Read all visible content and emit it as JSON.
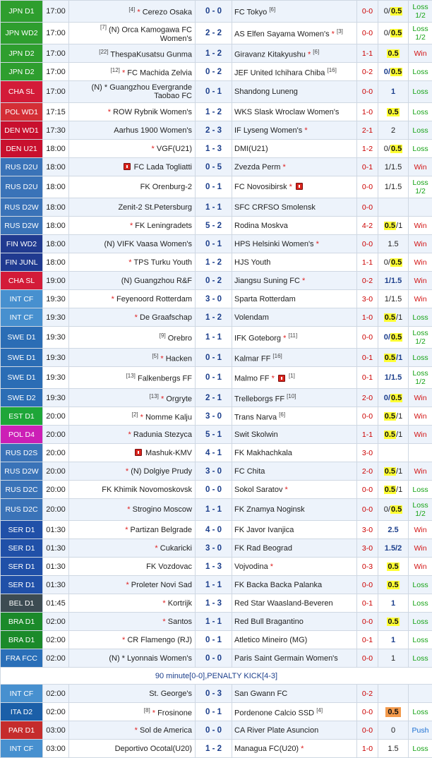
{
  "colors": {
    "jpn": "#2e9e2e",
    "cha": "#d31b38",
    "pol": "#d42e36",
    "den": "#c8102e",
    "rus": "#3a73b8",
    "fin": "#203a90",
    "intcf": "#4790cf",
    "swe": "#2b6db5",
    "est": "#1ea638",
    "pol4": "#cc1fb6",
    "ser": "#2050a8",
    "bel": "#3c4b52",
    "bra": "#1b8a2a",
    "fra": "#2a6fb8",
    "ita": "#1b5fa8",
    "par": "#c52c2c",
    "win": "#d21414",
    "loss": "#17a317",
    "push": "#1b6fd3"
  },
  "matches": [
    {
      "league": "JPN D1",
      "color": "jpn",
      "time": "17:00",
      "home_rank": "[4]",
      "home_star": true,
      "home": "Cerezo Osaka",
      "score": "0 - 0",
      "away": "FC Tokyo",
      "away_rank": "[6]",
      "ht": "0-0",
      "odds": [
        {
          "t": "0/",
          "s": ""
        },
        {
          "t": "0.5",
          "s": "hl"
        }
      ],
      "result": "Loss 1/2",
      "rc": "loss",
      "tall": true
    },
    {
      "league": "JPN WD2",
      "color": "jpn",
      "time": "17:00",
      "home_rank": "[7]",
      "home": "(N) Orca Kamogawa FC Women's",
      "score": "2 - 2",
      "away": "AS Elfen Sayama Women's",
      "away_star": true,
      "away_rank": "[3]",
      "ht": "0-0",
      "odds": [
        {
          "t": "0/",
          "s": ""
        },
        {
          "t": "0.5",
          "s": "hl"
        }
      ],
      "result": "Loss 1/2",
      "rc": "loss",
      "tall": true
    },
    {
      "league": "JPN D2",
      "color": "jpn",
      "time": "17:00",
      "home_rank": "[22]",
      "home": "ThespaKusatsu Gunma",
      "score": "1 - 2",
      "away": "Giravanz Kitakyushu",
      "away_star": true,
      "away_rank": "[6]",
      "ht": "1-1",
      "odds": [
        {
          "t": "0.5",
          "s": "hl"
        }
      ],
      "result": "Win",
      "rc": "win"
    },
    {
      "league": "JPN D2",
      "color": "jpn",
      "time": "17:00",
      "home_rank": "[12]",
      "home_star": true,
      "home": "FC Machida Zelvia",
      "score": "0 - 2",
      "away": "JEF United Ichihara Chiba",
      "away_rank": "[16]",
      "ht": "0-2",
      "odds": [
        {
          "t": "0/",
          "s": "b"
        },
        {
          "t": "0.5",
          "s": "hl"
        }
      ],
      "result": "Loss",
      "rc": "loss"
    },
    {
      "league": "CHA SL",
      "color": "cha",
      "time": "17:00",
      "home": "(N) * Guangzhou Evergrande Taobao FC",
      "score": "0 - 1",
      "away": "Shandong Luneng",
      "ht": "0-0",
      "odds": [
        {
          "t": "1",
          "s": "b"
        }
      ],
      "result": "Loss",
      "rc": "loss",
      "tall": true
    },
    {
      "league": "POL WD1",
      "color": "pol",
      "time": "17:15",
      "home_star": true,
      "home": "ROW Rybnik Women's",
      "score": "1 - 2",
      "away": "WKS Slask Wroclaw Women's",
      "ht": "1-0",
      "odds": [
        {
          "t": "0.5",
          "s": "hl"
        }
      ],
      "result": "Loss",
      "rc": "loss"
    },
    {
      "league": "DEN WD1",
      "color": "den",
      "time": "17:30",
      "home": "Aarhus 1900 Women's",
      "score": "2 - 3",
      "away": "IF Lyseng Women's",
      "away_star": true,
      "ht": "2-1",
      "odds": [
        {
          "t": "2",
          "s": ""
        }
      ],
      "result": "Loss",
      "rc": "loss"
    },
    {
      "league": "DEN U21",
      "color": "den",
      "time": "18:00",
      "home_star": true,
      "home": "VGF(U21)",
      "score": "1 - 3",
      "away": "DMI(U21)",
      "ht": "1-2",
      "odds": [
        {
          "t": "0/",
          "s": ""
        },
        {
          "t": "0.5",
          "s": "hl"
        }
      ],
      "result": "Loss",
      "rc": "loss"
    },
    {
      "league": "RUS D2U",
      "color": "rus",
      "time": "18:00",
      "home_card": true,
      "home": "FC Lada Togliatti",
      "score": "0 - 5",
      "away": "Zvezda Perm",
      "away_star": true,
      "ht": "0-1",
      "odds": [
        {
          "t": "1/1.5",
          "s": ""
        }
      ],
      "result": "Win",
      "rc": "win"
    },
    {
      "league": "RUS D2U",
      "color": "rus",
      "time": "18:00",
      "home": "FK Orenburg-2",
      "score": "0 - 1",
      "away": "FC Novosibirsk",
      "away_star": true,
      "away_card": true,
      "ht": "0-0",
      "odds": [
        {
          "t": "1/1.5",
          "s": ""
        }
      ],
      "result": "Loss 1/2",
      "rc": "loss",
      "tall": true
    },
    {
      "league": "RUS D2W",
      "color": "rus",
      "time": "18:00",
      "home": "Zenit-2 St.Petersburg",
      "score": "1 - 1",
      "away": "SFC CRFSO Smolensk",
      "ht": "0-0",
      "odds": [],
      "result": "",
      "rc": "loss"
    },
    {
      "league": "RUS D2W",
      "color": "rus",
      "time": "18:00",
      "home_star": true,
      "home": "FK Leningradets",
      "score": "5 - 2",
      "away": "Rodina Moskva",
      "ht": "4-2",
      "odds": [
        {
          "t": "0.5",
          "s": "hl"
        },
        {
          "t": "/1",
          "s": ""
        }
      ],
      "result": "Win",
      "rc": "win"
    },
    {
      "league": "FIN WD2",
      "color": "fin",
      "time": "18:00",
      "home": "(N) VIFK Vaasa Women's",
      "score": "0 - 1",
      "away": "HPS Helsinki Women's",
      "away_star": true,
      "ht": "0-0",
      "odds": [
        {
          "t": "1.5",
          "s": ""
        }
      ],
      "result": "Win",
      "rc": "win"
    },
    {
      "league": "FIN JUNL",
      "color": "fin",
      "time": "18:00",
      "home_star": true,
      "home": "TPS Turku Youth",
      "score": "1 - 2",
      "away": "HJS Youth",
      "ht": "1-1",
      "odds": [
        {
          "t": "0/",
          "s": ""
        },
        {
          "t": "0.5",
          "s": "hl"
        }
      ],
      "result": "Win",
      "rc": "win"
    },
    {
      "league": "CHA SL",
      "color": "cha",
      "time": "19:00",
      "home": "(N) Guangzhou R&F",
      "score": "0 - 2",
      "away": "Jiangsu Suning FC",
      "away_star": true,
      "ht": "0-2",
      "odds": [
        {
          "t": "1/1.5",
          "s": "b"
        }
      ],
      "result": "Win",
      "rc": "win"
    },
    {
      "league": "INT CF",
      "color": "intcf",
      "time": "19:30",
      "home_star": true,
      "home": "Feyenoord Rotterdam",
      "score": "3 - 0",
      "away": "Sparta Rotterdam",
      "ht": "3-0",
      "odds": [
        {
          "t": "1/1.5",
          "s": ""
        }
      ],
      "result": "Win",
      "rc": "win"
    },
    {
      "league": "INT CF",
      "color": "intcf",
      "time": "19:30",
      "home_star": true,
      "home": "De Graafschap",
      "score": "1 - 2",
      "away": "Volendam",
      "ht": "1-0",
      "odds": [
        {
          "t": "0.5",
          "s": "hl"
        },
        {
          "t": "/1",
          "s": ""
        }
      ],
      "result": "Loss",
      "rc": "loss"
    },
    {
      "league": "SWE D1",
      "color": "swe",
      "time": "19:30",
      "home_rank": "[9]",
      "home": "Orebro",
      "score": "1 - 1",
      "away": "IFK Goteborg",
      "away_star": true,
      "away_rank": "[11]",
      "ht": "0-0",
      "odds": [
        {
          "t": "0/",
          "s": "b"
        },
        {
          "t": "0.5",
          "s": "hl"
        }
      ],
      "result": "Loss 1/2",
      "rc": "loss",
      "tall": true
    },
    {
      "league": "SWE D1",
      "color": "swe",
      "time": "19:30",
      "home_rank": "[5]",
      "home_star": true,
      "home": "Hacken",
      "score": "0 - 1",
      "away": "Kalmar FF",
      "away_rank": "[16]",
      "ht": "0-1",
      "odds": [
        {
          "t": "0.5",
          "s": "hl"
        },
        {
          "t": "/1",
          "s": "b"
        }
      ],
      "result": "Loss",
      "rc": "loss"
    },
    {
      "league": "SWE D1",
      "color": "swe",
      "time": "19:30",
      "home_rank": "[13]",
      "home": "Falkenbergs FF",
      "score": "0 - 1",
      "away": "Malmo FF",
      "away_star": true,
      "away_card": true,
      "away_rank": "[1]",
      "ht": "0-1",
      "odds": [
        {
          "t": "1/1.5",
          "s": "b"
        }
      ],
      "result": "Loss 1/2",
      "rc": "loss",
      "tall": true
    },
    {
      "league": "SWE D2",
      "color": "swe",
      "time": "19:30",
      "home_rank": "[13]",
      "home_star": true,
      "home": "Orgryte",
      "score": "2 - 1",
      "away": "Trelleborgs FF",
      "away_rank": "[10]",
      "ht": "2-0",
      "odds": [
        {
          "t": "0/",
          "s": "b"
        },
        {
          "t": "0.5",
          "s": "hl"
        }
      ],
      "result": "Win",
      "rc": "win"
    },
    {
      "league": "EST D1",
      "color": "est",
      "time": "20:00",
      "home_rank": "[2]",
      "home_star": true,
      "home": "Nomme Kalju",
      "score": "3 - 0",
      "away": "Trans Narva",
      "away_rank": "[6]",
      "ht": "0-0",
      "odds": [
        {
          "t": "0.5",
          "s": "hl"
        },
        {
          "t": "/1",
          "s": ""
        }
      ],
      "result": "Win",
      "rc": "win"
    },
    {
      "league": "POL D4",
      "color": "pol4",
      "time": "20:00",
      "home_star": true,
      "home": "Radunia Stezyca",
      "score": "5 - 1",
      "away": "Swit Skolwin",
      "ht": "1-1",
      "odds": [
        {
          "t": "0.5",
          "s": "hl"
        },
        {
          "t": "/1",
          "s": ""
        }
      ],
      "result": "Win",
      "rc": "win"
    },
    {
      "league": "RUS D2S",
      "color": "rus",
      "time": "20:00",
      "home_card": true,
      "home": "Mashuk-KMV",
      "score": "4 - 1",
      "away": "FK Makhachkala",
      "ht": "3-0",
      "odds": [],
      "result": "",
      "rc": "loss"
    },
    {
      "league": "RUS D2W",
      "color": "rus",
      "time": "20:00",
      "home_star": true,
      "home": "(N) Dolgiye Prudy",
      "score": "3 - 0",
      "away": "FC Chita",
      "ht": "2-0",
      "odds": [
        {
          "t": "0.5",
          "s": "hl"
        },
        {
          "t": "/1",
          "s": ""
        }
      ],
      "result": "Win",
      "rc": "win"
    },
    {
      "league": "RUS D2C",
      "color": "rus",
      "time": "20:00",
      "home": "FK Khimik Novomoskovsk",
      "score": "0 - 0",
      "away": "Sokol Saratov",
      "away_star": true,
      "ht": "0-0",
      "odds": [
        {
          "t": "0.5",
          "s": "hl"
        },
        {
          "t": "/1",
          "s": ""
        }
      ],
      "result": "Loss",
      "rc": "loss"
    },
    {
      "league": "RUS D2C",
      "color": "rus",
      "time": "20:00",
      "home_star": true,
      "home": "Strogino Moscow",
      "score": "1 - 1",
      "away": "FK Znamya Noginsk",
      "ht": "0-0",
      "odds": [
        {
          "t": "0/",
          "s": ""
        },
        {
          "t": "0.5",
          "s": "hl"
        }
      ],
      "result": "Loss 1/2",
      "rc": "loss",
      "tall": true
    },
    {
      "league": "SER D1",
      "color": "ser",
      "time": "01:30",
      "home_star": true,
      "home": "Partizan Belgrade",
      "score": "4 - 0",
      "away": "FK Javor Ivanjica",
      "ht": "3-0",
      "odds": [
        {
          "t": "2.5",
          "s": "b"
        }
      ],
      "result": "Win",
      "rc": "win"
    },
    {
      "league": "SER D1",
      "color": "ser",
      "time": "01:30",
      "home_star": true,
      "home": "Cukaricki",
      "score": "3 - 0",
      "away": "FK Rad Beograd",
      "ht": "3-0",
      "odds": [
        {
          "t": "1.5/2",
          "s": "b"
        }
      ],
      "result": "Win",
      "rc": "win"
    },
    {
      "league": "SER D1",
      "color": "ser",
      "time": "01:30",
      "home": "FK Vozdovac",
      "score": "1 - 3",
      "away": "Vojvodina",
      "away_star": true,
      "ht": "0-3",
      "odds": [
        {
          "t": "0.5",
          "s": "hl"
        }
      ],
      "result": "Win",
      "rc": "win"
    },
    {
      "league": "SER D1",
      "color": "ser",
      "time": "01:30",
      "home_star": true,
      "home": "Proleter Novi Sad",
      "score": "1 - 1",
      "away": "FK Backa Backa Palanka",
      "ht": "0-0",
      "odds": [
        {
          "t": "0.5",
          "s": "hl"
        }
      ],
      "result": "Loss",
      "rc": "loss"
    },
    {
      "league": "BEL D1",
      "color": "bel",
      "time": "01:45",
      "home_star": true,
      "home": "Kortrijk",
      "score": "1 - 3",
      "away": "Red Star Waasland-Beveren",
      "ht": "0-1",
      "odds": [
        {
          "t": "1",
          "s": "b"
        }
      ],
      "result": "Loss",
      "rc": "loss"
    },
    {
      "league": "BRA D1",
      "color": "bra",
      "time": "02:00",
      "home_star": true,
      "home": "Santos",
      "score": "1 - 1",
      "away": "Red Bull Bragantino",
      "ht": "0-0",
      "odds": [
        {
          "t": "0.5",
          "s": "hl"
        }
      ],
      "result": "Loss",
      "rc": "loss"
    },
    {
      "league": "BRA D1",
      "color": "bra",
      "time": "02:00",
      "home_star": true,
      "home": "CR Flamengo (RJ)",
      "score": "0 - 1",
      "away": "Atletico Mineiro (MG)",
      "ht": "0-1",
      "odds": [
        {
          "t": "1",
          "s": "b"
        }
      ],
      "result": "Loss",
      "rc": "loss"
    },
    {
      "league": "FRA FCC",
      "color": "fra",
      "time": "02:00",
      "home": "(N) * Lyonnais Women's",
      "score": "0 - 0",
      "away": "Paris Saint Germain Women's",
      "ht": "0-0",
      "odds": [
        {
          "t": "1",
          "s": ""
        }
      ],
      "result": "Loss",
      "rc": "loss"
    }
  ],
  "note": "90 minute[0-0],PENALTY KICK[4-3]",
  "matches2": [
    {
      "league": "INT CF",
      "color": "intcf",
      "time": "02:00",
      "home": "St. George's",
      "score": "0 - 3",
      "away": "San Gwann FC",
      "ht": "0-2",
      "odds": [],
      "result": "",
      "rc": "loss"
    },
    {
      "league": "ITA D2",
      "color": "ita",
      "time": "02:00",
      "home_rank": "[8]",
      "home_star": true,
      "home": "Frosinone",
      "score": "0 - 1",
      "away": "Pordenone Calcio SSD",
      "away_rank": "[4]",
      "ht": "0-0",
      "odds": [
        {
          "t": "0.5",
          "s": "or"
        }
      ],
      "result": "Loss",
      "rc": "loss"
    },
    {
      "league": "PAR D1",
      "color": "par",
      "time": "03:00",
      "home_star": true,
      "home": "Sol de America",
      "score": "0 - 0",
      "away": "CA River Plate Asuncion",
      "ht": "0-0",
      "odds": [
        {
          "t": "0",
          "s": ""
        }
      ],
      "result": "Push",
      "rc": "push"
    },
    {
      "league": "INT CF",
      "color": "intcf",
      "time": "03:00",
      "home": "Deportivo Ocotal(U20)",
      "score": "1 - 2",
      "away": "Managua FC(U20)",
      "away_star": true,
      "ht": "1-0",
      "odds": [
        {
          "t": "1.5",
          "s": ""
        }
      ],
      "result": "Loss",
      "rc": "loss"
    }
  ]
}
